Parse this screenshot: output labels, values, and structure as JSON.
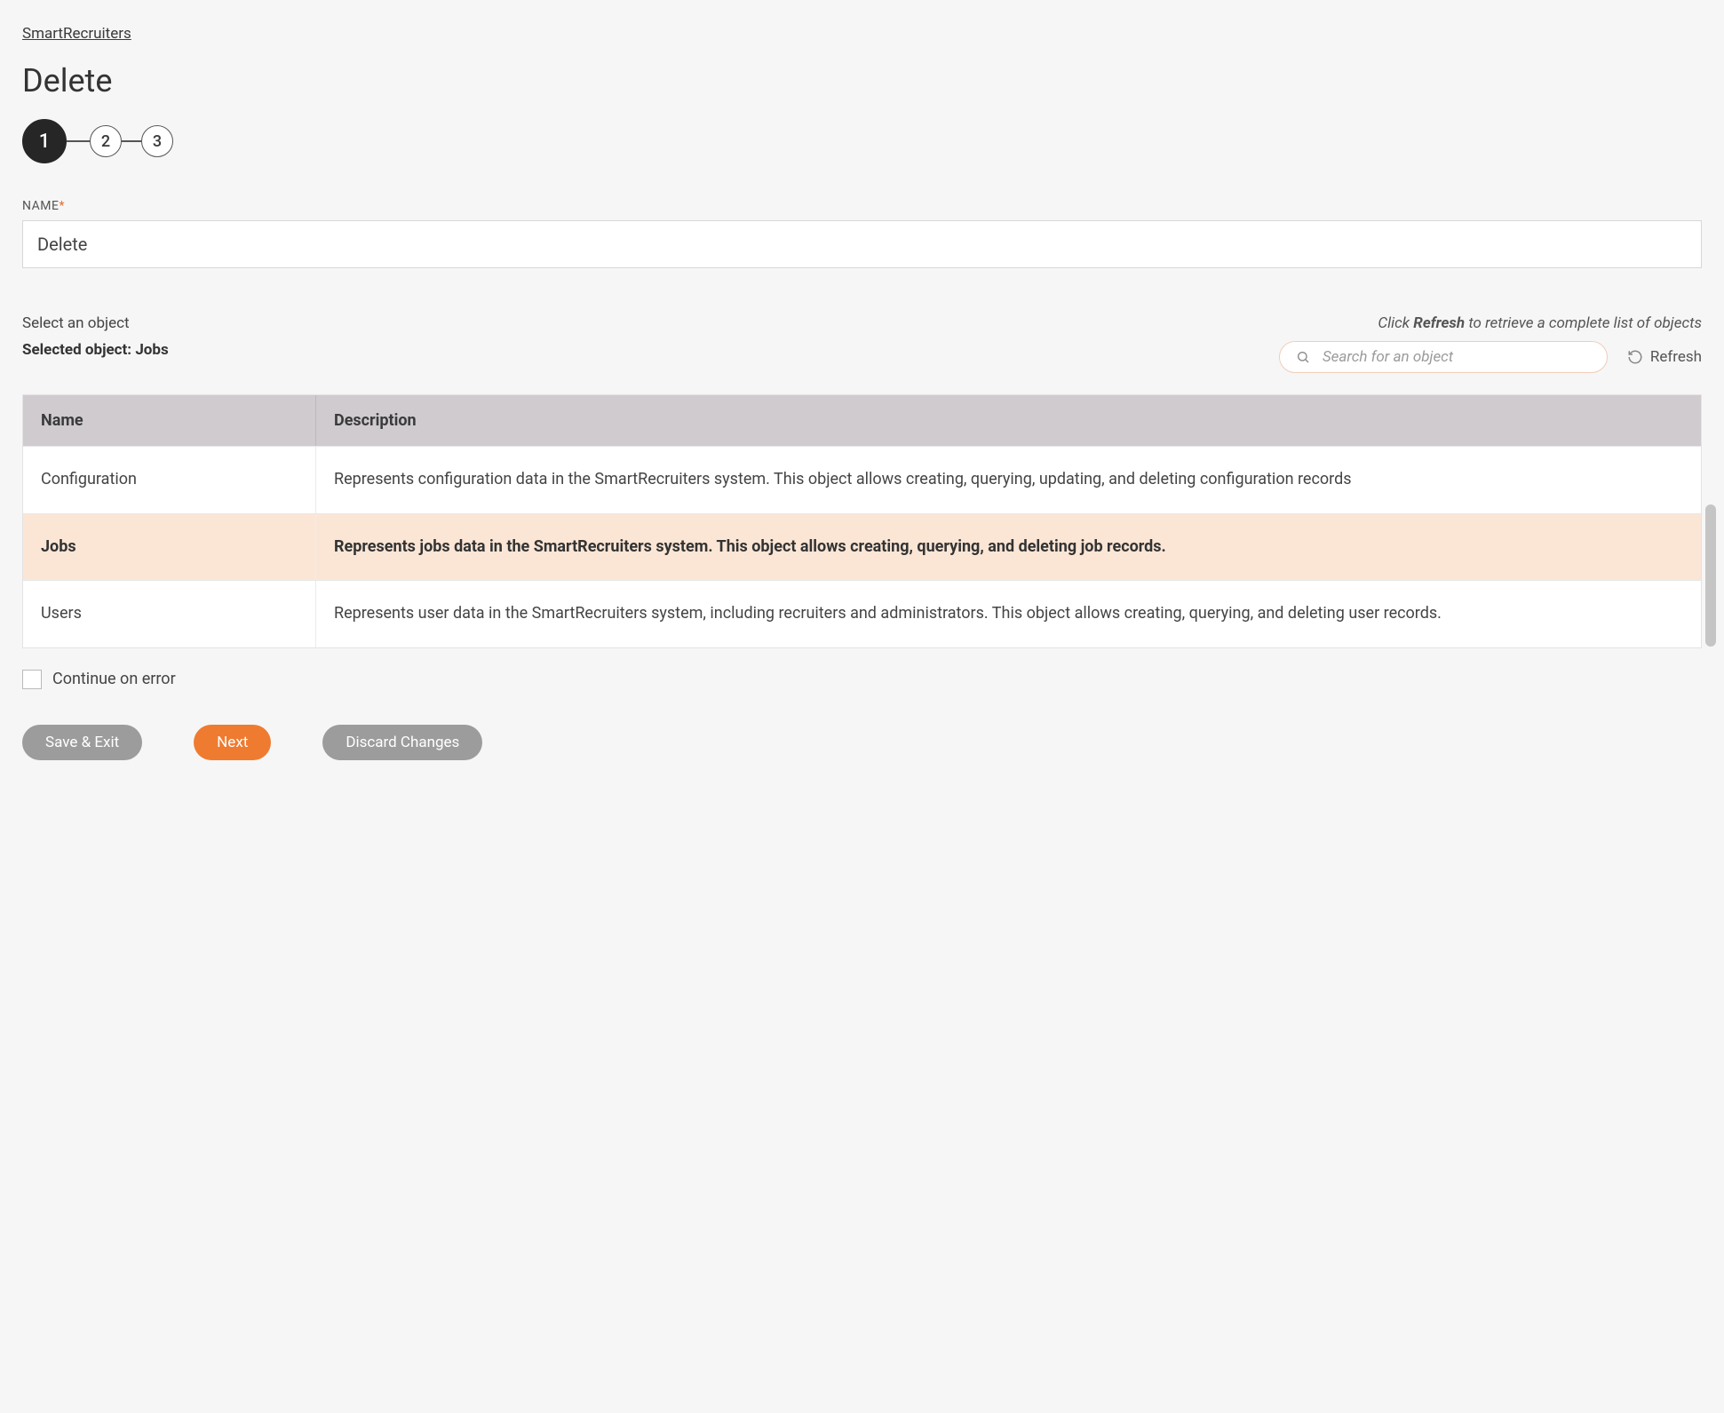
{
  "breadcrumb": {
    "label": "SmartRecruiters"
  },
  "page": {
    "title": "Delete"
  },
  "stepper": {
    "steps": [
      "1",
      "2",
      "3"
    ],
    "active_index": 0
  },
  "form": {
    "name_label": "NAME",
    "name_required_marker": "*",
    "name_value": "Delete"
  },
  "object_select": {
    "label": "Select an object",
    "selected_prefix": "Selected object: ",
    "selected_value": "Jobs",
    "hint_pre": "Click ",
    "hint_bold": "Refresh",
    "hint_post": " to retrieve a complete list of objects",
    "search_placeholder": "Search for an object",
    "refresh_label": "Refresh"
  },
  "table": {
    "columns": {
      "name": "Name",
      "description": "Description"
    },
    "rows": [
      {
        "name": "Configuration",
        "description": "Represents configuration data in the SmartRecruiters system. This object allows creating, querying, updating, and deleting configuration records",
        "selected": false
      },
      {
        "name": "Jobs",
        "description": "Represents jobs data in the SmartRecruiters system. This object allows creating, querying, and deleting job records.",
        "selected": true
      },
      {
        "name": "Users",
        "description": "Represents user data in the SmartRecruiters system, including recruiters and administrators. This object allows creating, querying, and deleting user records.",
        "selected": false
      }
    ]
  },
  "continue_on_error": {
    "label": "Continue on error",
    "checked": false
  },
  "buttons": {
    "save_exit": "Save & Exit",
    "next": "Next",
    "discard": "Discard Changes"
  }
}
